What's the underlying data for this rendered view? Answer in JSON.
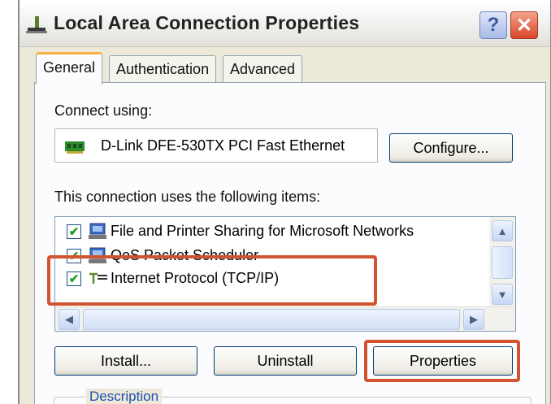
{
  "window": {
    "title": "Local Area Connection Properties",
    "help_label": "?",
    "close_label": "✕"
  },
  "tabs": [
    {
      "label": "General",
      "active": true
    },
    {
      "label": "Authentication",
      "active": false
    },
    {
      "label": "Advanced",
      "active": false
    }
  ],
  "connect_using": {
    "label": "Connect using:",
    "adapter": "D-Link DFE-530TX PCI Fast Ethernet",
    "configure_label": "Configure..."
  },
  "items_section": {
    "label": "This connection uses the following items:",
    "items": [
      {
        "label": "File and Printer Sharing for Microsoft Networks",
        "checked": true,
        "icon": "network-sharing-icon"
      },
      {
        "label": "QoS Packet Scheduler",
        "checked": true,
        "icon": "network-service-icon"
      },
      {
        "label": "Internet Protocol (TCP/IP)",
        "checked": true,
        "icon": "protocol-icon",
        "highlighted": true
      }
    ]
  },
  "buttons": {
    "install": "Install...",
    "uninstall": "Uninstall",
    "properties": "Properties"
  },
  "description": {
    "label": "Description"
  },
  "colors": {
    "highlight": "#d2532f",
    "dialog_bg": "#ece9d8",
    "active_tab_accent": "#f7b143"
  }
}
